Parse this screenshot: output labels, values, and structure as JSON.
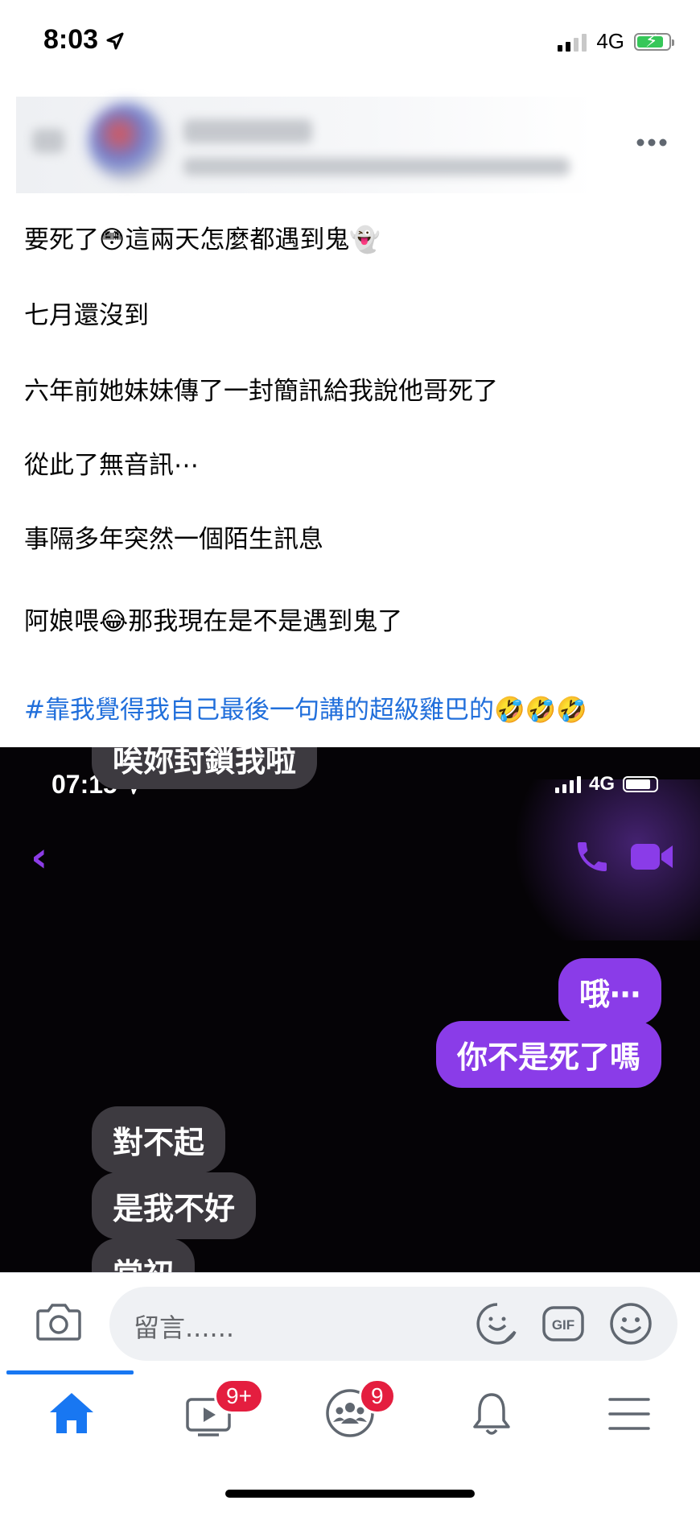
{
  "status_bar": {
    "time": "8:03",
    "network": "4G"
  },
  "post": {
    "lines": [
      "要死了😳這兩天怎麼都遇到鬼👻",
      "七月還沒到",
      "六年前她妹妹傳了一封簡訊給我說他哥死了",
      "從此了無音訊⋯",
      "事隔多年突然一個陌生訊息",
      "阿娘喂😂那我現在是不是遇到鬼了"
    ],
    "hashtag": "#靠我覺得我自己最後一句講的超級雞巴的🤣🤣🤣"
  },
  "embedded_screenshot": {
    "time": "07:15",
    "network": "4G",
    "messages": [
      {
        "side": "left",
        "text": "唉妳封鎖我啦"
      },
      {
        "side": "right",
        "text": "哦⋯"
      },
      {
        "side": "right",
        "text": "你不是死了嗎"
      },
      {
        "side": "left",
        "text": "對不起"
      },
      {
        "side": "left",
        "text": "是我不好"
      },
      {
        "side": "left",
        "text": "當初"
      }
    ]
  },
  "comment_bar": {
    "placeholder": "留言......"
  },
  "nav": {
    "watch_badge": "9+",
    "groups_badge": "9",
    "accent": "#1877f2"
  }
}
